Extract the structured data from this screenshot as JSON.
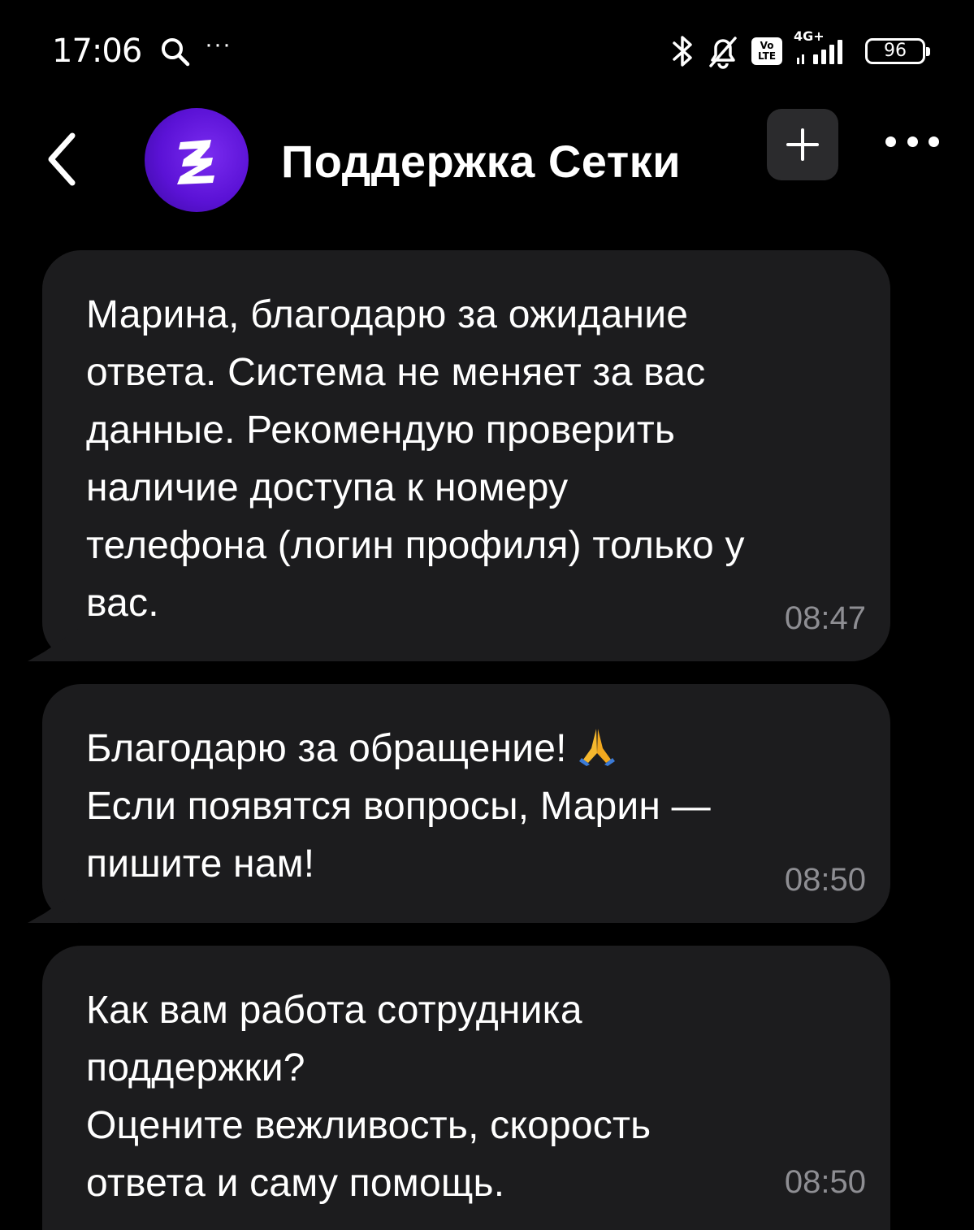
{
  "status_bar": {
    "time": "17:06",
    "more": "···",
    "network": "4G+",
    "volte_top": "Vo",
    "volte_bottom": "LTE",
    "battery": "96"
  },
  "header": {
    "title": "Поддержка Сетки",
    "back_icon": "chevron-left-icon",
    "add_icon": "plus-icon",
    "menu_icon": "more-horizontal-icon"
  },
  "messages": [
    {
      "text": "Марина, благодарю за ожидание\nответа. Система не меняет за вас\nданные. Рекомендую проверить\nналичие доступа к номеру\nтелефона (логин профиля) только у\nвас.",
      "time": "08:47"
    },
    {
      "text": "Благодарю за обращение!",
      "text_rest": "Если появятся вопросы, Марин —\nпишите нам!",
      "time": "08:50"
    },
    {
      "text": "Как вам работа сотрудника\nподдержки?\nОцените вежливость, скорость\nответа и саму помощь.",
      "time": "08:50"
    }
  ],
  "colors": {
    "background": "#000000",
    "bubble": "#1c1c1e",
    "timestamp": "#8e8e93",
    "avatar": "#5b12d6",
    "add_button": "#2b2b2d"
  }
}
